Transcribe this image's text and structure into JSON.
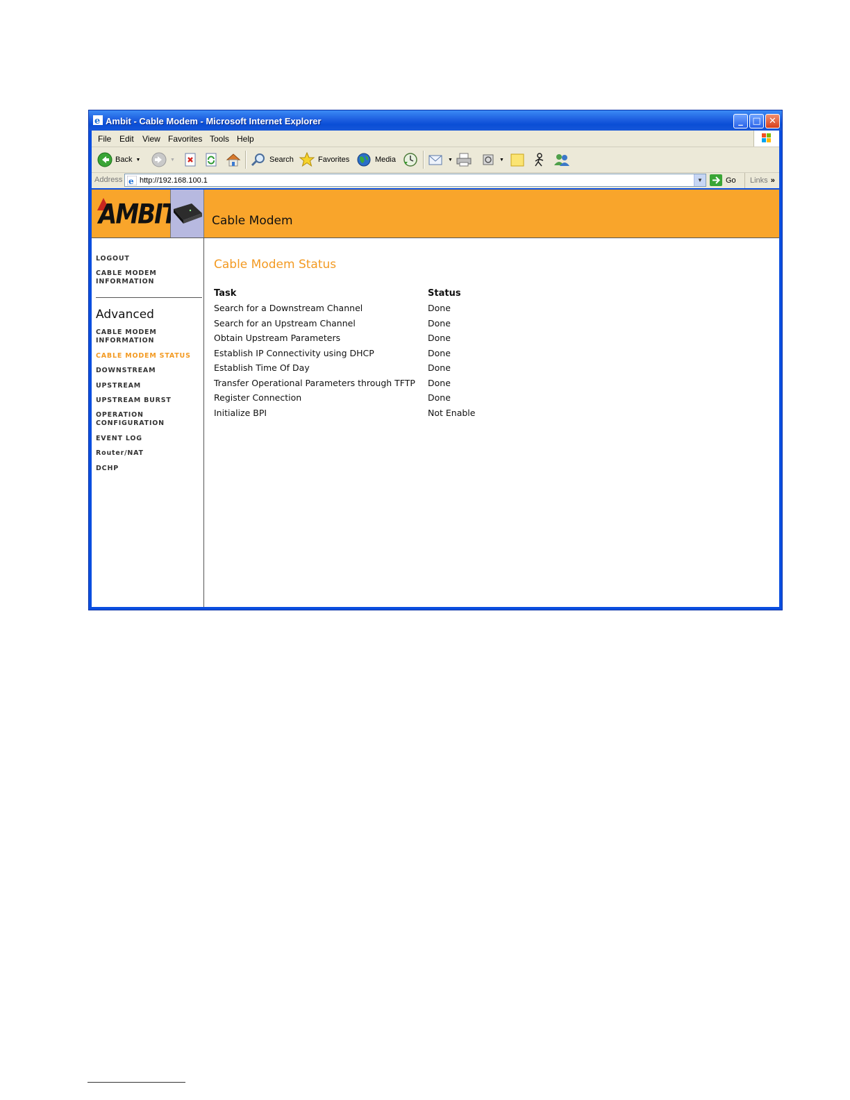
{
  "window": {
    "title": "Ambit - Cable Modem - Microsoft Internet Explorer"
  },
  "menu": [
    "File",
    "Edit",
    "View",
    "Favorites",
    "Tools",
    "Help"
  ],
  "toolbar": {
    "back": "Back",
    "search": "Search",
    "favorites": "Favorites",
    "media": "Media"
  },
  "address": {
    "label": "Address",
    "url": "http://192.168.100.1",
    "go": "Go",
    "links": "Links"
  },
  "header": {
    "logo": "AMBIT",
    "title": "Cable Modem"
  },
  "sidebar": {
    "top_items": [
      "LOGOUT",
      "CABLE MODEM INFORMATION"
    ],
    "section": "Advanced",
    "items": [
      "CABLE MODEM INFORMATION",
      "CABLE MODEM STATUS",
      "DOWNSTREAM",
      "UPSTREAM",
      "UPSTREAM BURST",
      "OPERATION CONFIGURATION",
      "EVENT LOG",
      "Router/NAT",
      "DCHP"
    ],
    "active_index": 1
  },
  "main": {
    "title": "Cable Modem Status",
    "columns": [
      "Task",
      "Status"
    ],
    "rows": [
      {
        "task": "Search for a Downstream Channel",
        "status": "Done"
      },
      {
        "task": "Search for an Upstream Channel",
        "status": "Done"
      },
      {
        "task": "Obtain Upstream Parameters",
        "status": "Done"
      },
      {
        "task": "Establish IP Connectivity using DHCP",
        "status": "Done"
      },
      {
        "task": "Establish Time Of Day",
        "status": "Done"
      },
      {
        "task": "Transfer Operational Parameters through TFTP",
        "status": "Done"
      },
      {
        "task": "Register Connection",
        "status": "Done"
      },
      {
        "task": "Initialize BPI",
        "status": "Not Enable"
      }
    ]
  },
  "colors": {
    "accent": "#f9a52b",
    "active_link": "#f39a22",
    "titlebar": "#0a4ee0"
  }
}
